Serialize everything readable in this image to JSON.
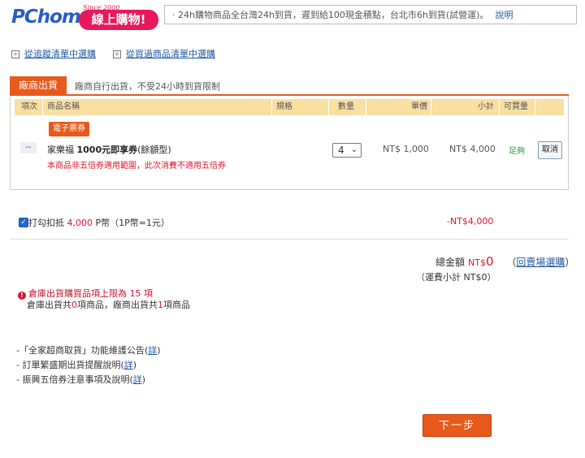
{
  "header": {
    "logo_text": "PChome",
    "logo_since": "Since 2000",
    "logo_cart": "線上購物!",
    "announcement": "·  24h購物商品全台灣24h到貨，遲到給100現金積點，台北市6h到貨(試營運)。",
    "explain_link": "說明"
  },
  "links": {
    "from_wishlist": "從追蹤清單中選購",
    "from_history": "從買過商品清單中選購"
  },
  "vendor": {
    "tab": "廠商出貨",
    "note": "廠商自行出貨，不受24小時到貨限制"
  },
  "table": {
    "headers": [
      "項次",
      "商品名稱",
      "規格",
      "數量",
      "單價",
      "小計",
      "可買量"
    ]
  },
  "item": {
    "tag": "電子票券",
    "index": "--",
    "name_prefix": "家樂福 ",
    "name_bold": "1000元即享券",
    "name_suffix": "(餘額型)",
    "warning": "本商品非五倍券適用範圍，此次消費不適用五倍券",
    "qty": "4",
    "unit_price": "NT$ 1,000",
    "subtotal": "NT$ 4,000",
    "stock": "足夠",
    "cancel": "取消"
  },
  "points": {
    "checked": true,
    "label": "打勾扣抵",
    "amount": "4,000",
    "unit": " P幣（1P幣=1元）",
    "deduct": "-NT$4,000"
  },
  "total": {
    "label": "總金額",
    "currency": "NT$",
    "value": "0",
    "back_open": "（",
    "back_link": "回賣場選購",
    "back_close": "）",
    "shipping": "（運費小計 NT$0）"
  },
  "limits": {
    "error": "倉庫出貨購買品項上限為 15 項",
    "summary_pre": "倉庫出貨共",
    "warehouse_count": "0",
    "summary_mid": "項商品，廠商出貨共",
    "vendor_count": "1",
    "summary_post": "項商品"
  },
  "notes": [
    {
      "text": "-「全家超商取貨」功能維護公告(",
      "link": "詳",
      "end": ")"
    },
    {
      "text": "- 訂單繁盛期出貨提醒說明(",
      "link": "詳",
      "end": ")"
    },
    {
      "text": "- 振興五倍券注意事項及說明(",
      "link": "詳",
      "end": ")"
    }
  ],
  "buttons": {
    "next": "下一步"
  },
  "colors": {
    "accent": "#e85a1b",
    "header_bg": "#f9dfa2",
    "alert": "#e0152e",
    "link": "#1f55a8"
  }
}
